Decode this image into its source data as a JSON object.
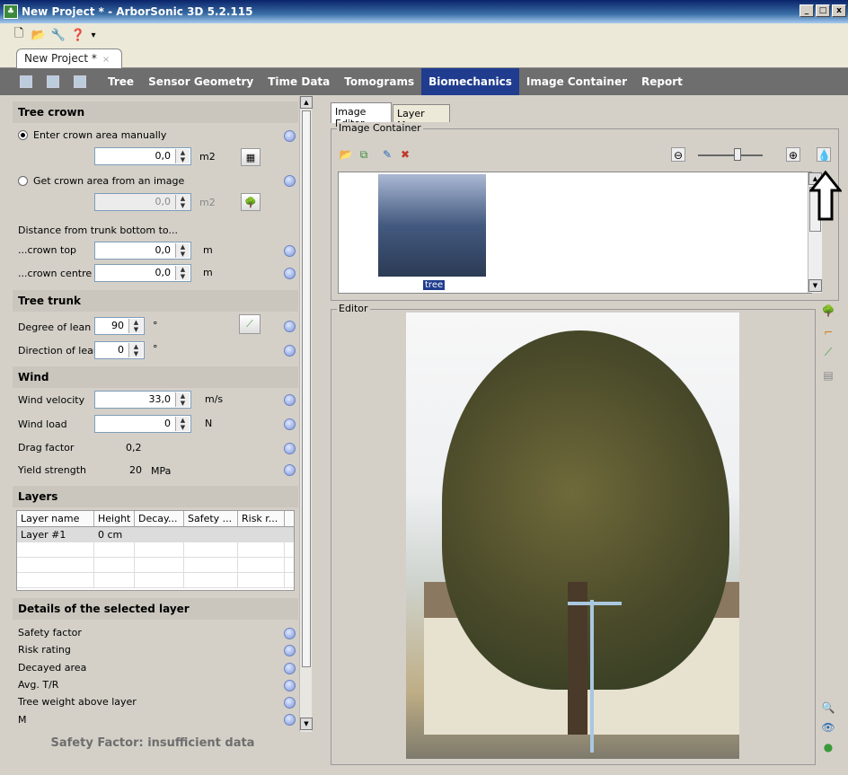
{
  "window": {
    "title": "New Project * - ArborSonic 3D 5.2.115",
    "min": "_",
    "max": "□",
    "close": "x"
  },
  "toolbar": {
    "new": "🗋",
    "open": "📂",
    "settings": "🔧",
    "help": "❓",
    "dropdown": "▾"
  },
  "doc_tab": {
    "label": "New Project *",
    "close": "×"
  },
  "nav": {
    "tabs": [
      "Tree",
      "Sensor Geometry",
      "Time Data",
      "Tomograms",
      "Biomechanics",
      "Image Container",
      "Report"
    ],
    "active": "Biomechanics"
  },
  "left": {
    "tree_crown": {
      "header": "Tree crown",
      "manual_label": "Enter crown area manually",
      "manual_value": "0,0",
      "manual_unit": "m2",
      "image_label": "Get crown area from an image",
      "image_value": "0,0",
      "image_unit": "m2",
      "distance_label": "Distance from trunk bottom to...",
      "crown_top_label": "...crown top",
      "crown_top_value": "0,0",
      "crown_top_unit": "m",
      "crown_centre_label": "...crown centre",
      "crown_centre_value": "0,0",
      "crown_centre_unit": "m"
    },
    "tree_trunk": {
      "header": "Tree trunk",
      "lean_label": "Degree of lean",
      "lean_value": "90",
      "lean_unit": "°",
      "direction_label": "Direction of lean",
      "direction_value": "0",
      "direction_unit": "°"
    },
    "wind": {
      "header": "Wind",
      "velocity_label": "Wind velocity",
      "velocity_value": "33,0",
      "velocity_unit": "m/s",
      "load_label": "Wind load",
      "load_value": "0",
      "load_unit": "N",
      "drag_label": "Drag factor",
      "drag_value": "0,2",
      "yield_label": "Yield strength",
      "yield_value": "20",
      "yield_unit": "MPa"
    },
    "layers": {
      "header": "Layers",
      "columns": [
        "Layer name",
        "Height",
        "Decay...",
        "Safety ...",
        "Risk r..."
      ],
      "rows": [
        [
          "Layer #1",
          "0 cm",
          "",
          "",
          ""
        ]
      ]
    },
    "details": {
      "header": "Details of the selected layer",
      "items": [
        "Safety factor",
        "Risk rating",
        "Decayed area",
        "Avg. T/R",
        "Tree weight above layer",
        "M"
      ]
    },
    "safety_status": "Safety Factor: insufficient data"
  },
  "right": {
    "tabs": [
      "Image Editor",
      "Layer Map"
    ],
    "image_container_title": "Image Container",
    "thumbnail_label": "tree",
    "editor_title": "Editor"
  },
  "icons": {
    "help": "help-icon",
    "calculator": "calculator-icon",
    "tree": "tree-icon",
    "leaf": "leaf-icon",
    "zoom_out": "⊖",
    "zoom_in": "⊕",
    "arrow": "⇧"
  },
  "colors": {
    "nav_bg": "#6e6e6e",
    "nav_active": "#1f3c8f",
    "selection": "#1f3c8f",
    "status_text": "#6e6e6e"
  }
}
